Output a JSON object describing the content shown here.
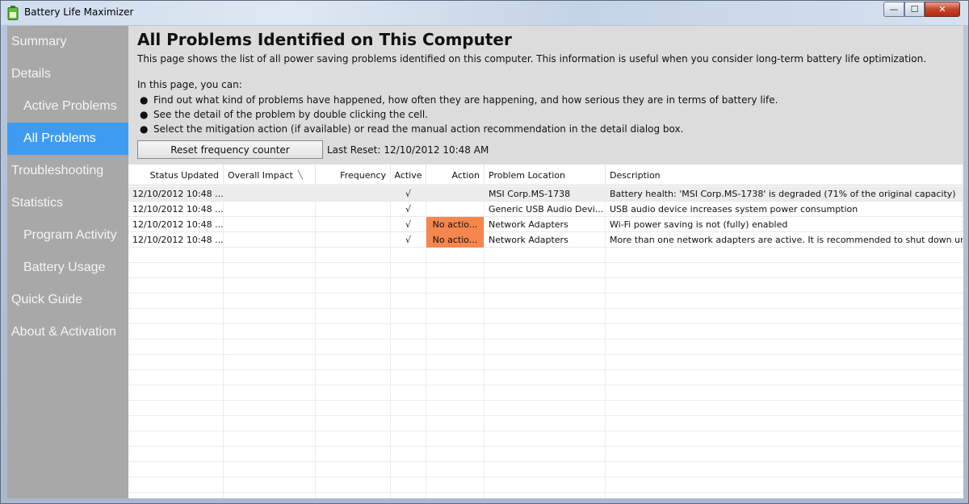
{
  "window": {
    "title": "Battery Life Maximizer",
    "min_glyph": "—",
    "max_glyph": "☐",
    "close_glyph": "✕"
  },
  "sidebar": {
    "items": [
      {
        "label": "Summary",
        "level": "top"
      },
      {
        "label": "Details",
        "level": "top"
      },
      {
        "label": "Active Problems",
        "level": "sub"
      },
      {
        "label": "All Problems",
        "level": "sub",
        "active": true
      },
      {
        "label": "Troubleshooting",
        "level": "top"
      },
      {
        "label": "Statistics",
        "level": "top"
      },
      {
        "label": "Program Activity",
        "level": "sub"
      },
      {
        "label": "Battery Usage",
        "level": "sub"
      },
      {
        "label": "Quick Guide",
        "level": "top"
      },
      {
        "label": "About & Activation",
        "level": "top"
      }
    ]
  },
  "header": {
    "title": "All Problems Identified on This Computer",
    "description": "This page shows the list of all power saving problems identified on this computer. This information is useful when you consider long-term battery life optimization.",
    "can_intro": "In this page, you can:",
    "bullets": [
      "Find out what kind of problems have happened, how often they are happening, and how serious they are in terms of battery life.",
      "See the detail of the problem by double clicking the cell.",
      "Select the mitigation action (if available) or read the manual action recommendation in the detail dialog box."
    ],
    "reset_button": "Reset frequency counter",
    "last_reset_label": "Last Reset:",
    "last_reset_value": "12/10/2012 10:48 AM"
  },
  "table": {
    "columns": [
      "Status Updated",
      "Overall Impact",
      "Frequency",
      "Active",
      "Action",
      "Problem Location",
      "Description"
    ],
    "rows": [
      {
        "status": "12/10/2012 10:48 ...",
        "impact": "",
        "frequency": "",
        "active": "√",
        "action": "",
        "location": "MSI Corp.MS-1738",
        "description": "Battery health: 'MSI Corp.MS-1738' is degraded (71% of the original capacity)"
      },
      {
        "status": "12/10/2012 10:48 ...",
        "impact": "",
        "frequency": "",
        "active": "√",
        "action": "",
        "location": "Generic USB Audio Devi...",
        "description": "USB audio device increases system power consumption"
      },
      {
        "status": "12/10/2012 10:48 ...",
        "impact": "",
        "frequency": "",
        "active": "√",
        "action": "No actio...",
        "location": "Network Adapters",
        "description": "Wi-Fi power saving is not (fully) enabled"
      },
      {
        "status": "12/10/2012 10:48 ...",
        "impact": "",
        "frequency": "",
        "active": "√",
        "action": "No actio...",
        "location": "Network Adapters",
        "description": "More than one network adapters are active. It is recommended to shut down un..."
      }
    ],
    "action_color": "#f5864d"
  },
  "colors": {
    "sidebar_bg": "#a8a8a8",
    "sidebar_active": "#3e9cf0",
    "header_bg": "#dcdcdc"
  }
}
